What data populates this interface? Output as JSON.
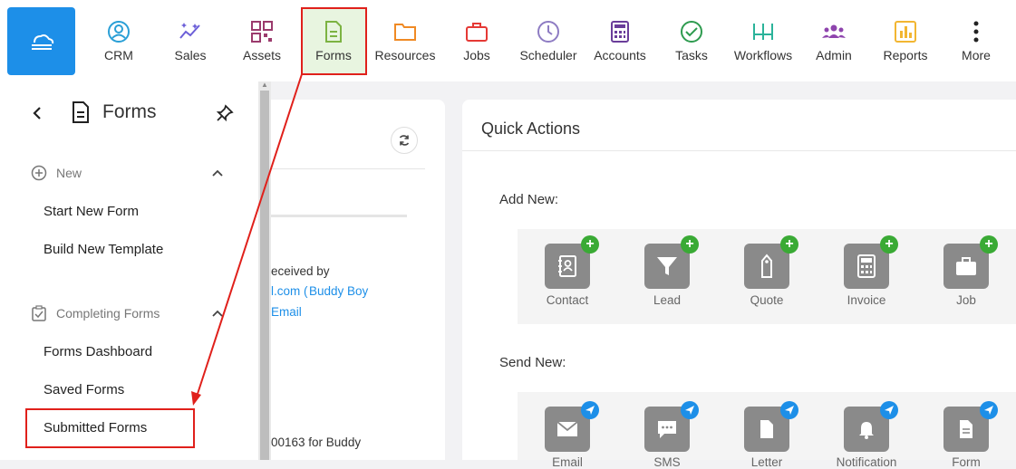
{
  "nav": {
    "items": [
      {
        "label": "CRM",
        "icon": "crm-icon",
        "color": "#2a9fd6"
      },
      {
        "label": "Sales",
        "icon": "sales-icon",
        "color": "#6c5fd8"
      },
      {
        "label": "Assets",
        "icon": "assets-icon",
        "color": "#9b3b6d"
      },
      {
        "label": "Forms",
        "icon": "forms-icon",
        "color": "#7cb342"
      },
      {
        "label": "Resources",
        "icon": "resources-icon",
        "color": "#f08a24"
      },
      {
        "label": "Jobs",
        "icon": "jobs-icon",
        "color": "#e53935"
      },
      {
        "label": "Scheduler",
        "icon": "scheduler-icon",
        "color": "#8e7cc3"
      },
      {
        "label": "Accounts",
        "icon": "accounts-icon",
        "color": "#6a3d9a"
      },
      {
        "label": "Tasks",
        "icon": "tasks-icon",
        "color": "#2e9b4f"
      },
      {
        "label": "Workflows",
        "icon": "workflows-icon",
        "color": "#2bb39a"
      },
      {
        "label": "Admin",
        "icon": "admin-icon",
        "color": "#8e44ad"
      },
      {
        "label": "Reports",
        "icon": "reports-icon",
        "color": "#f2b632"
      },
      {
        "label": "More",
        "icon": "more-icon",
        "color": "#222222"
      }
    ]
  },
  "sidebar": {
    "title": "Forms",
    "new_section": "New",
    "new_items": [
      "Start New Form",
      "Build New Template"
    ],
    "completing_section": "Completing Forms",
    "completing_items": [
      "Forms Dashboard",
      "Saved Forms",
      "Submitted Forms"
    ]
  },
  "left_panel": {
    "frag_received": "eceived by",
    "frag_email": "l.com (",
    "frag_name": "Buddy Boy",
    "frag_email_link": "Email",
    "frag_bottom": "00163 for Buddy"
  },
  "quick_actions": {
    "title": "Quick Actions",
    "add_new_label": "Add New:",
    "send_new_label": "Send New:",
    "add_items": [
      "Contact",
      "Lead",
      "Quote",
      "Invoice",
      "Job"
    ],
    "send_items": [
      "Email",
      "SMS",
      "Letter",
      "Notification",
      "Form"
    ]
  },
  "colors": {
    "brand": "#1d8fe8",
    "highlight": "#e0201b",
    "link": "#1d8fe8"
  }
}
